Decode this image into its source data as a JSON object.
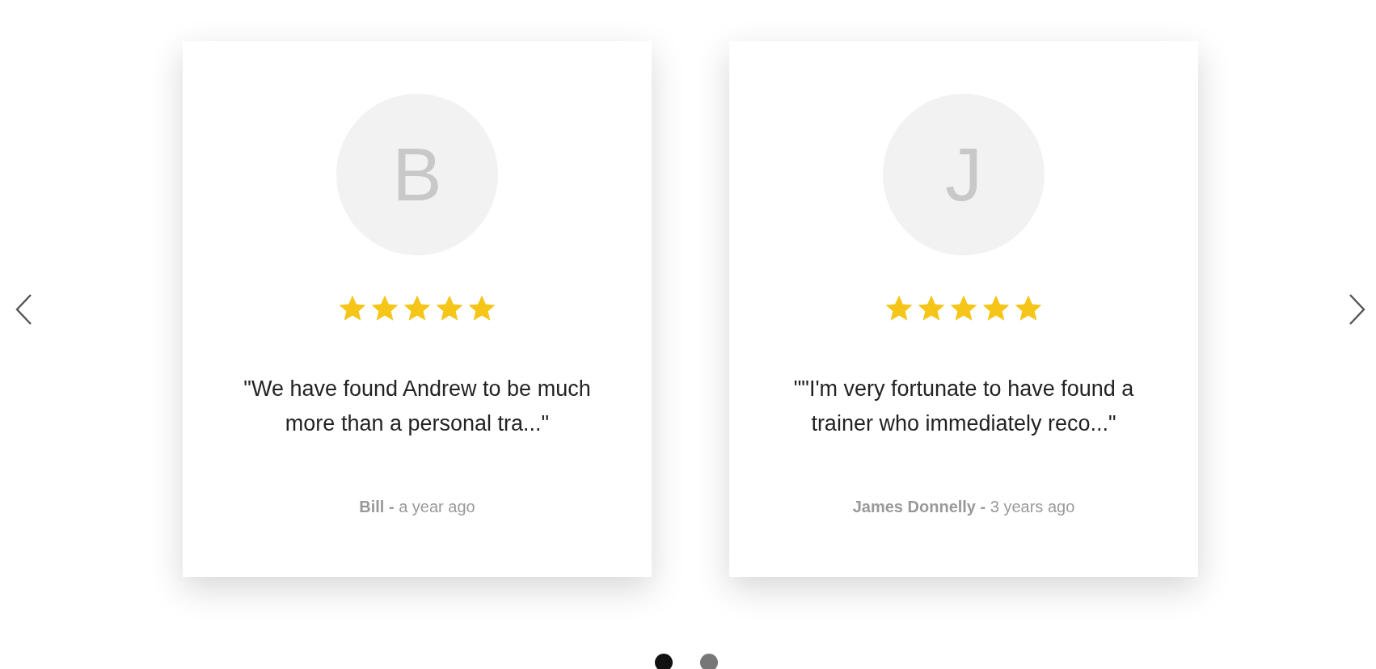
{
  "reviews": [
    {
      "initial": "B",
      "stars": 5,
      "quote": "\"We have found Andrew to be much more than a personal tra...\"",
      "byline": "**Bill -** a year ago"
    },
    {
      "initial": "J",
      "stars": 5,
      "quote": "\"\"I'm very fortunate to have found a trainer who immediately reco...\"",
      "byline": "**James Donnelly -** 3 years ago"
    }
  ],
  "dots": [
    {
      "selected": true
    },
    {
      "selected": false
    }
  ]
}
